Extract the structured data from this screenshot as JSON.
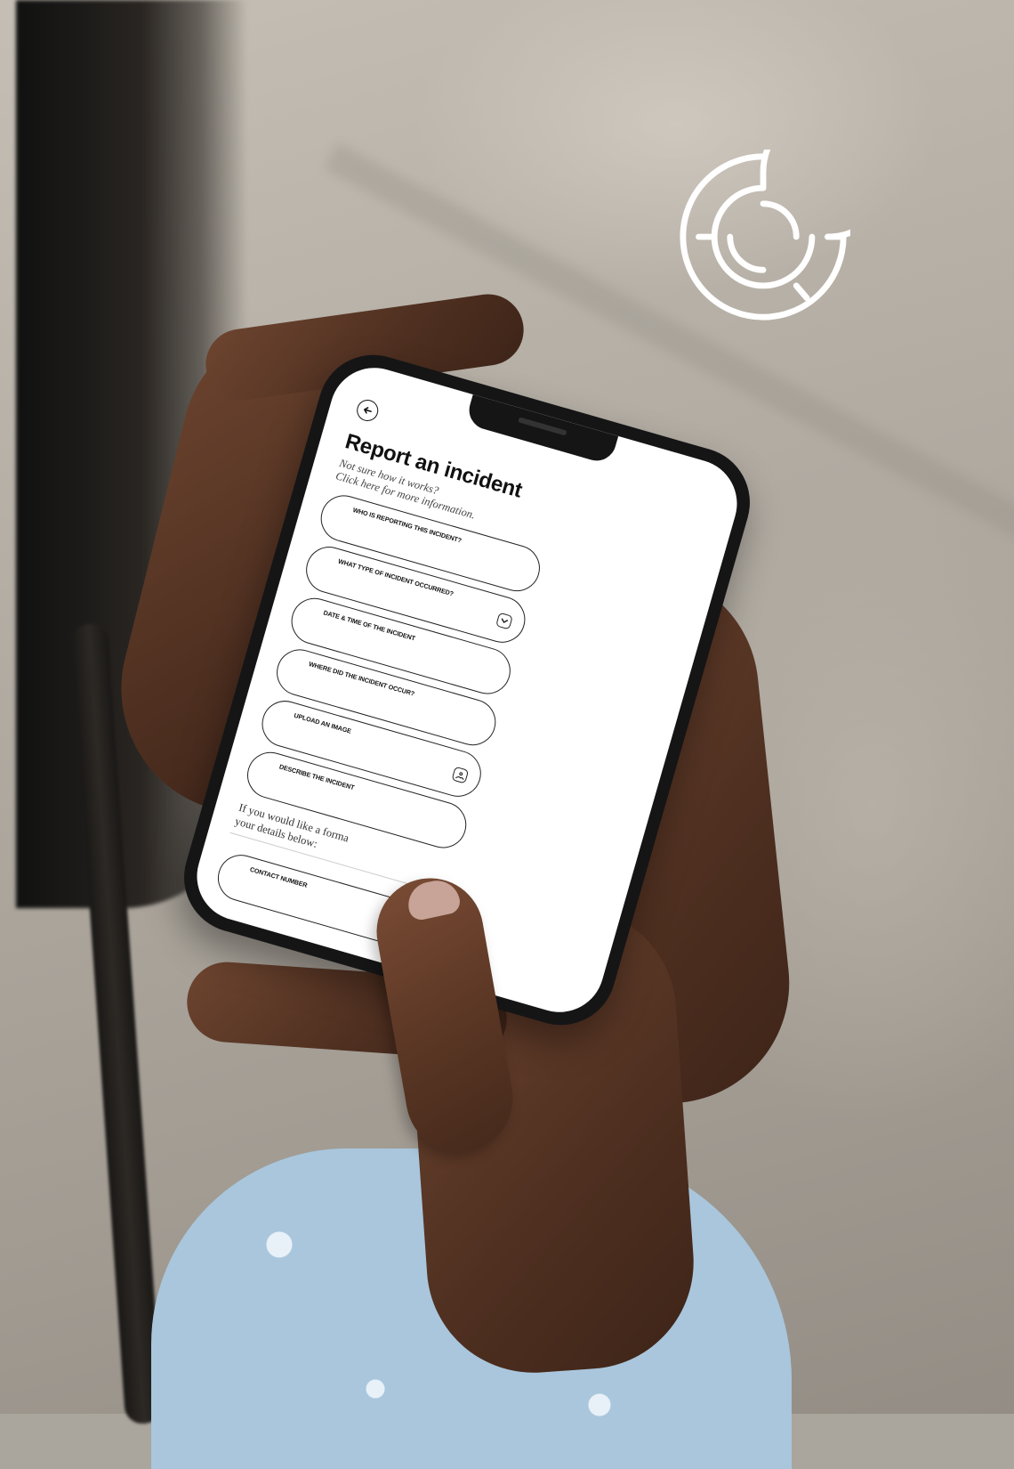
{
  "screen": {
    "title": "Report an incident",
    "subtitle_line1": "Not sure how it works?",
    "subtitle_line2": "Click here for more information.",
    "fields": [
      {
        "label": "WHO IS REPORTING THIS INCIDENT?",
        "icon": ""
      },
      {
        "label": "WHAT TYPE OF INCIDENT OCCURRED?",
        "icon": "chevron-down-icon"
      },
      {
        "label": "DATE & TIME OF THE INCIDENT",
        "icon": ""
      },
      {
        "label": "WHERE DID THE INCIDENT OCCUR?",
        "icon": ""
      },
      {
        "label": "UPLOAD AN IMAGE",
        "icon": "image-upload-icon"
      },
      {
        "label": "DESCRIBE THE INCIDENT",
        "icon": ""
      }
    ],
    "formal_line1": "If you would like a forma",
    "formal_line2": "your details below:",
    "contact_label": "CONTACT NUMBER"
  },
  "icons": {
    "back": "back-arrow-icon",
    "logo": "maze-logo-icon"
  },
  "colors": {
    "screen_bg": "#ffffff",
    "field_border": "#222222",
    "phone_body": "#151516",
    "logo": "#ffffff"
  }
}
